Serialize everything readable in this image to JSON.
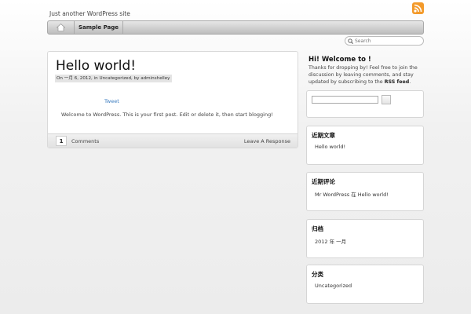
{
  "header": {
    "tagline": "Just another WordPress site",
    "rss_icon": "rss-icon"
  },
  "nav": {
    "home_icon": "home-icon",
    "items": [
      {
        "label": "Sample Page"
      }
    ]
  },
  "search": {
    "placeholder": "Search",
    "icon": "search-icon"
  },
  "post": {
    "title": "Hello world!",
    "meta": "On 一月 6, 2012, in Uncategorized, by adminshelley",
    "tweet_label": "Tweet",
    "excerpt": "Welcome to WordPress. This is your first post. Edit or delete it, then start blogging!",
    "comment_count": "1",
    "comments_label": "Comments",
    "leave_response": "Leave A Response"
  },
  "sidebar": {
    "welcome_title": "Hi! Welcome to !",
    "welcome_text": "Thanks for dropping by! Feel free to join the discussion by leaving comments, and stay updated by subscribing to the",
    "rss_feed_label": "RSS feed",
    "welcome_end": ".",
    "widgets": [
      {
        "title": "近期文章",
        "items": [
          "Hello world!"
        ]
      },
      {
        "title": "近期评论",
        "items": [
          "Mr WordPress 在 Hello world!"
        ]
      },
      {
        "title": "归档",
        "items": [
          "2012 年 一月"
        ]
      },
      {
        "title": "分类",
        "items": [
          "Uncategorized"
        ]
      }
    ]
  }
}
